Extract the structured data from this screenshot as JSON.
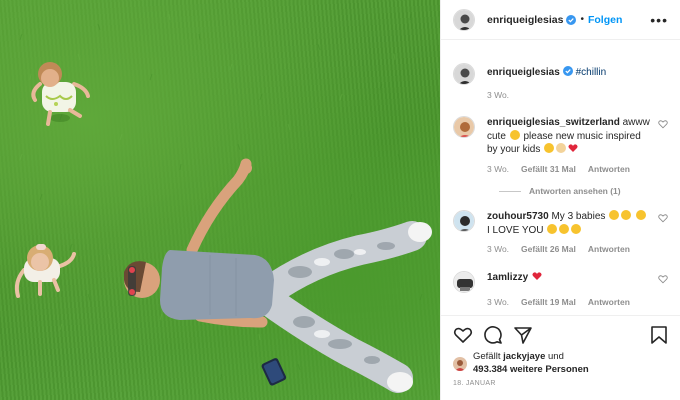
{
  "post": {
    "author": "enriqueiglesias",
    "follow_label": "Folgen",
    "dot": "•",
    "more": "•••",
    "caption_hashtag": "#chillin",
    "caption_time": "3 Wo."
  },
  "comments": [
    {
      "user": "enriqueiglesias_switzerland",
      "text_1": "awww cute",
      "text_2": "please new music inspired by your kids",
      "time": "3 Wo.",
      "likes": "Gefällt 31 Mal",
      "reply": "Antworten",
      "view_replies": "Antworten ansehen (1)"
    },
    {
      "user": "zouhour5730",
      "text_1": "My 3 babies",
      "text_2": "I LOVE YOU",
      "time": "3 Wo.",
      "likes": "Gefällt 26 Mal",
      "reply": "Antworten"
    },
    {
      "user": "1amlizzy",
      "time": "3 Wo.",
      "likes": "Gefällt 19 Mal",
      "reply": "Antworten"
    }
  ],
  "footer": {
    "liked_prefix": "Gefällt",
    "liked_user": "jackyjaye",
    "liked_and": "und",
    "liked_others": "493.384 weitere Personen",
    "date": "18. JANUAR"
  },
  "colors": {
    "accent": "#0095f6",
    "verified": "#3897f0",
    "grass": "#4f9c30",
    "heart": "#ed4956"
  },
  "icons": [
    "like-icon",
    "comment-icon",
    "share-icon",
    "save-icon",
    "verified-icon",
    "heart-icon"
  ]
}
